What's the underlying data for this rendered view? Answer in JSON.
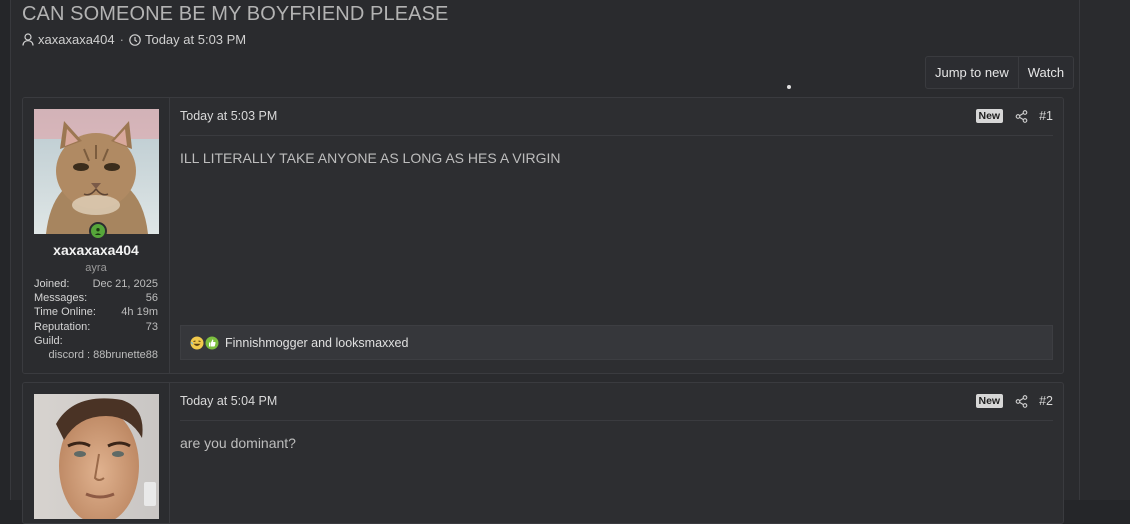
{
  "thread": {
    "title": "CAN SOMEONE BE MY BOYFRIEND PLEASE",
    "author": "xaxaxaxa404",
    "separator": "·",
    "date": "Today at 5:03 PM"
  },
  "buttons": {
    "jump_to_new": "Jump to new",
    "watch": "Watch"
  },
  "posts": [
    {
      "username": "xaxaxaxa404",
      "user_title": "ayra",
      "stats": [
        {
          "label": "Joined:",
          "value": "Dec 21, 2025"
        },
        {
          "label": "Messages:",
          "value": "56"
        },
        {
          "label": "Time Online:",
          "value": "4h 19m"
        },
        {
          "label": "Reputation:",
          "value": "73"
        }
      ],
      "guild_label": "Guild:",
      "guild_value": "discord : 88brunette88",
      "date": "Today at 5:03 PM",
      "badge": "New",
      "number": "#1",
      "text": "ILL LITERALLY TAKE ANYONE AS LONG AS HES A VIRGIN",
      "reactions_text": "Finnishmogger and looksmaxxed"
    },
    {
      "date": "Today at 5:04 PM",
      "badge": "New",
      "number": "#2",
      "text": "are you dominant?"
    }
  ],
  "icons": {
    "author": "user-icon",
    "date": "clock-icon",
    "share": "share-icon",
    "online": "online-status-icon",
    "reactions": [
      "laugh-emoji-icon",
      "thumbs-up-icon"
    ]
  },
  "colors": {
    "page_bg": "#2a2b2e",
    "post_bg": "#2d2e31",
    "online_green": "#56a63a",
    "like_green": "#7cbf3f",
    "laugh_yellow": "#f2c94c"
  }
}
